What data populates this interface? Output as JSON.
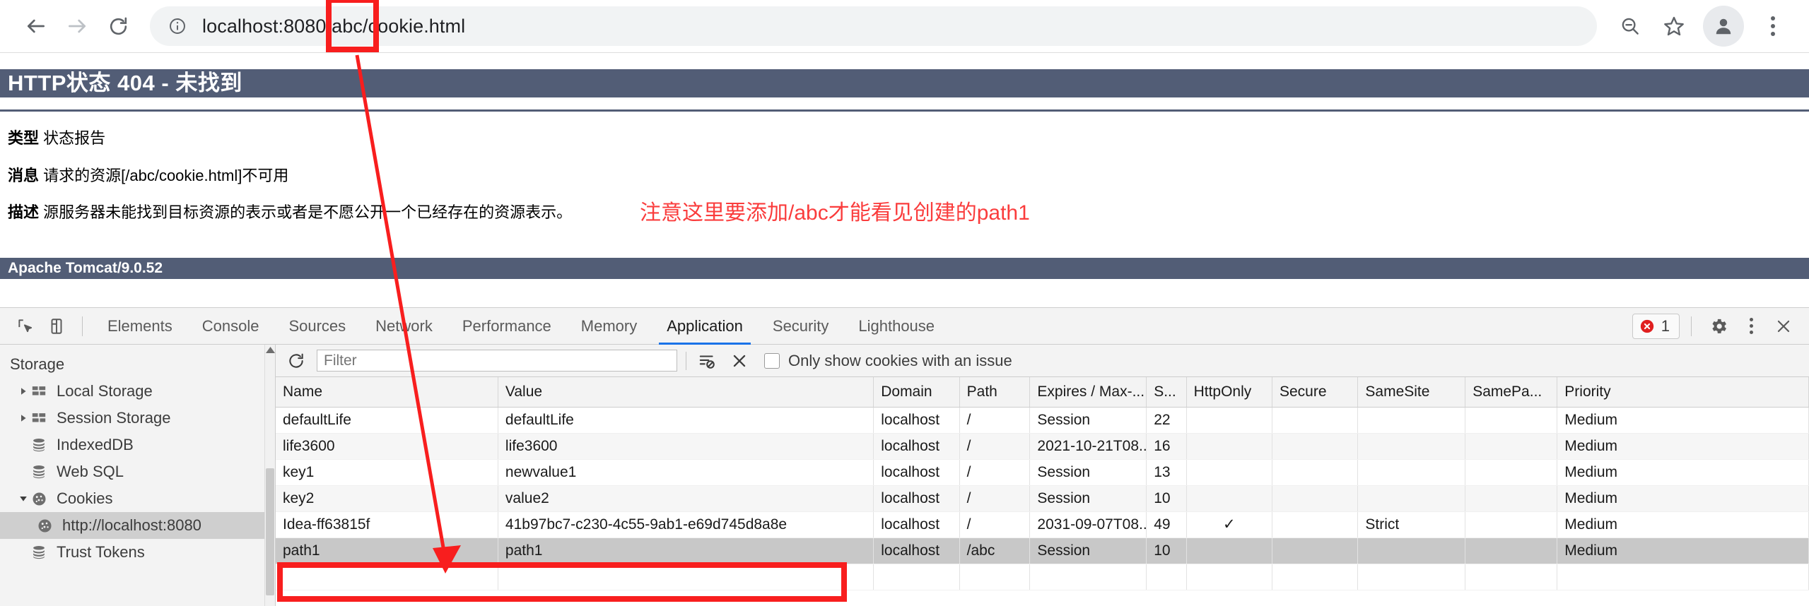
{
  "browser": {
    "nav": {
      "back_icon": "arrow-left-icon",
      "forward_icon": "arrow-right-icon",
      "reload_icon": "reload-icon"
    },
    "omnibox": {
      "site_info_icon": "info-circle-icon",
      "url_host": "localhost:8080",
      "url_path": "/abc/cookie.html",
      "url_full": "localhost:8080/abc/cookie.html"
    },
    "actions": {
      "zoom_out_icon": "zoom-out-icon",
      "bookmark_icon": "star-icon",
      "profile_icon": "person-icon",
      "menu_icon": "three-dots-vertical-icon"
    }
  },
  "error_page": {
    "title": "HTTP状态 404 - 未找到",
    "rows": [
      {
        "label": "类型",
        "text": "状态报告"
      },
      {
        "label": "消息",
        "text": "请求的资源[/abc/cookie.html]不可用"
      },
      {
        "label": "描述",
        "text": "源服务器未能找到目标资源的表示或者是不愿公开一个已经存在的资源表示。"
      }
    ],
    "footer": "Apache Tomcat/9.0.52",
    "annotation": "注意这里要添加/abc才能看见创建的path1",
    "annotation_color": "#fa3c3c",
    "header_color": "#525D76"
  },
  "devtools": {
    "tool_icons": {
      "inspect_icon": "inspect-element-icon",
      "device_toolbar_icon": "device-toggle-icon"
    },
    "tabs": [
      {
        "label": "Elements",
        "active": false
      },
      {
        "label": "Console",
        "active": false
      },
      {
        "label": "Sources",
        "active": false
      },
      {
        "label": "Network",
        "active": false
      },
      {
        "label": "Performance",
        "active": false
      },
      {
        "label": "Memory",
        "active": false
      },
      {
        "label": "Application",
        "active": true
      },
      {
        "label": "Security",
        "active": false
      },
      {
        "label": "Lighthouse",
        "active": false
      }
    ],
    "active_tab": "Application",
    "error_badge": {
      "icon": "error-circle-icon",
      "count": "1",
      "color": "#e02020"
    },
    "right_icons": {
      "settings_icon": "gear-icon",
      "more_icon": "three-dots-vertical-icon",
      "close_icon": "close-icon"
    },
    "accent_color": "#1a73e8"
  },
  "sidebar": {
    "heading": "Storage",
    "items": [
      {
        "label": "Local Storage",
        "icon": "grid-storage-icon",
        "twisty": "collapsed",
        "level": 1,
        "selected": false
      },
      {
        "label": "Session Storage",
        "icon": "grid-storage-icon",
        "twisty": "collapsed",
        "level": 1,
        "selected": false
      },
      {
        "label": "IndexedDB",
        "icon": "database-icon",
        "twisty": "none",
        "level": 1,
        "selected": false
      },
      {
        "label": "Web SQL",
        "icon": "database-icon",
        "twisty": "none",
        "level": 1,
        "selected": false
      },
      {
        "label": "Cookies",
        "icon": "cookie-icon",
        "twisty": "expanded",
        "level": 1,
        "selected": false
      },
      {
        "label": "http://localhost:8080",
        "icon": "cookie-icon",
        "twisty": "none",
        "level": 2,
        "selected": true
      },
      {
        "label": "Trust Tokens",
        "icon": "database-icon",
        "twisty": "none",
        "level": 1,
        "selected": false
      }
    ],
    "scrollbar_up_icon": "scroll-up-arrow-icon"
  },
  "cookies_toolbar": {
    "refresh_icon": "refresh-icon",
    "filter_placeholder": "Filter",
    "filter_value": "",
    "clear_filter_icon": "filter-clear-icon",
    "clear_all_icon": "clear-all-cookies-icon",
    "issue_checkbox_checked": false,
    "issue_label": "Only show cookies with an issue"
  },
  "cookies_table": {
    "columns": [
      "Name",
      "Value",
      "Domain",
      "Path",
      "Expires / Max-...",
      "S...",
      "HttpOnly",
      "Secure",
      "SameSite",
      "SamePa...",
      "Priority"
    ],
    "rows": [
      {
        "name": "defaultLife",
        "value": "defaultLife",
        "domain": "localhost",
        "path": "/",
        "expires": "Session",
        "size": "22",
        "httponly": "",
        "secure": "",
        "samesite": "",
        "samepartykey": "",
        "priority": "Medium",
        "selected": false
      },
      {
        "name": "life3600",
        "value": "life3600",
        "domain": "localhost",
        "path": "/",
        "expires": "2021-10-21T08...",
        "size": "16",
        "httponly": "",
        "secure": "",
        "samesite": "",
        "samepartykey": "",
        "priority": "Medium",
        "selected": false
      },
      {
        "name": "key1",
        "value": "newvalue1",
        "domain": "localhost",
        "path": "/",
        "expires": "Session",
        "size": "13",
        "httponly": "",
        "secure": "",
        "samesite": "",
        "samepartykey": "",
        "priority": "Medium",
        "selected": false
      },
      {
        "name": "key2",
        "value": "value2",
        "domain": "localhost",
        "path": "/",
        "expires": "Session",
        "size": "10",
        "httponly": "",
        "secure": "",
        "samesite": "",
        "samepartykey": "",
        "priority": "Medium",
        "selected": false
      },
      {
        "name": "Idea-ff63815f",
        "value": "41b97bc7-c230-4c55-9ab1-e69d745d8a8e",
        "domain": "localhost",
        "path": "/",
        "expires": "2031-09-07T08...",
        "size": "49",
        "httponly": "✓",
        "secure": "",
        "samesite": "Strict",
        "samepartykey": "",
        "priority": "Medium",
        "selected": false
      },
      {
        "name": "path1",
        "value": "path1",
        "domain": "localhost",
        "path": "/abc",
        "expires": "Session",
        "size": "10",
        "httponly": "",
        "secure": "",
        "samesite": "",
        "samepartykey": "",
        "priority": "Medium",
        "selected": true
      }
    ]
  },
  "annotations": {
    "highlight_color": "#f81e1e",
    "url_box": "red-rectangle-around-abc-segment",
    "row_box": "red-rectangle-around-path1-row",
    "arrow": "red-arrow-from-url-to-path1-row"
  }
}
